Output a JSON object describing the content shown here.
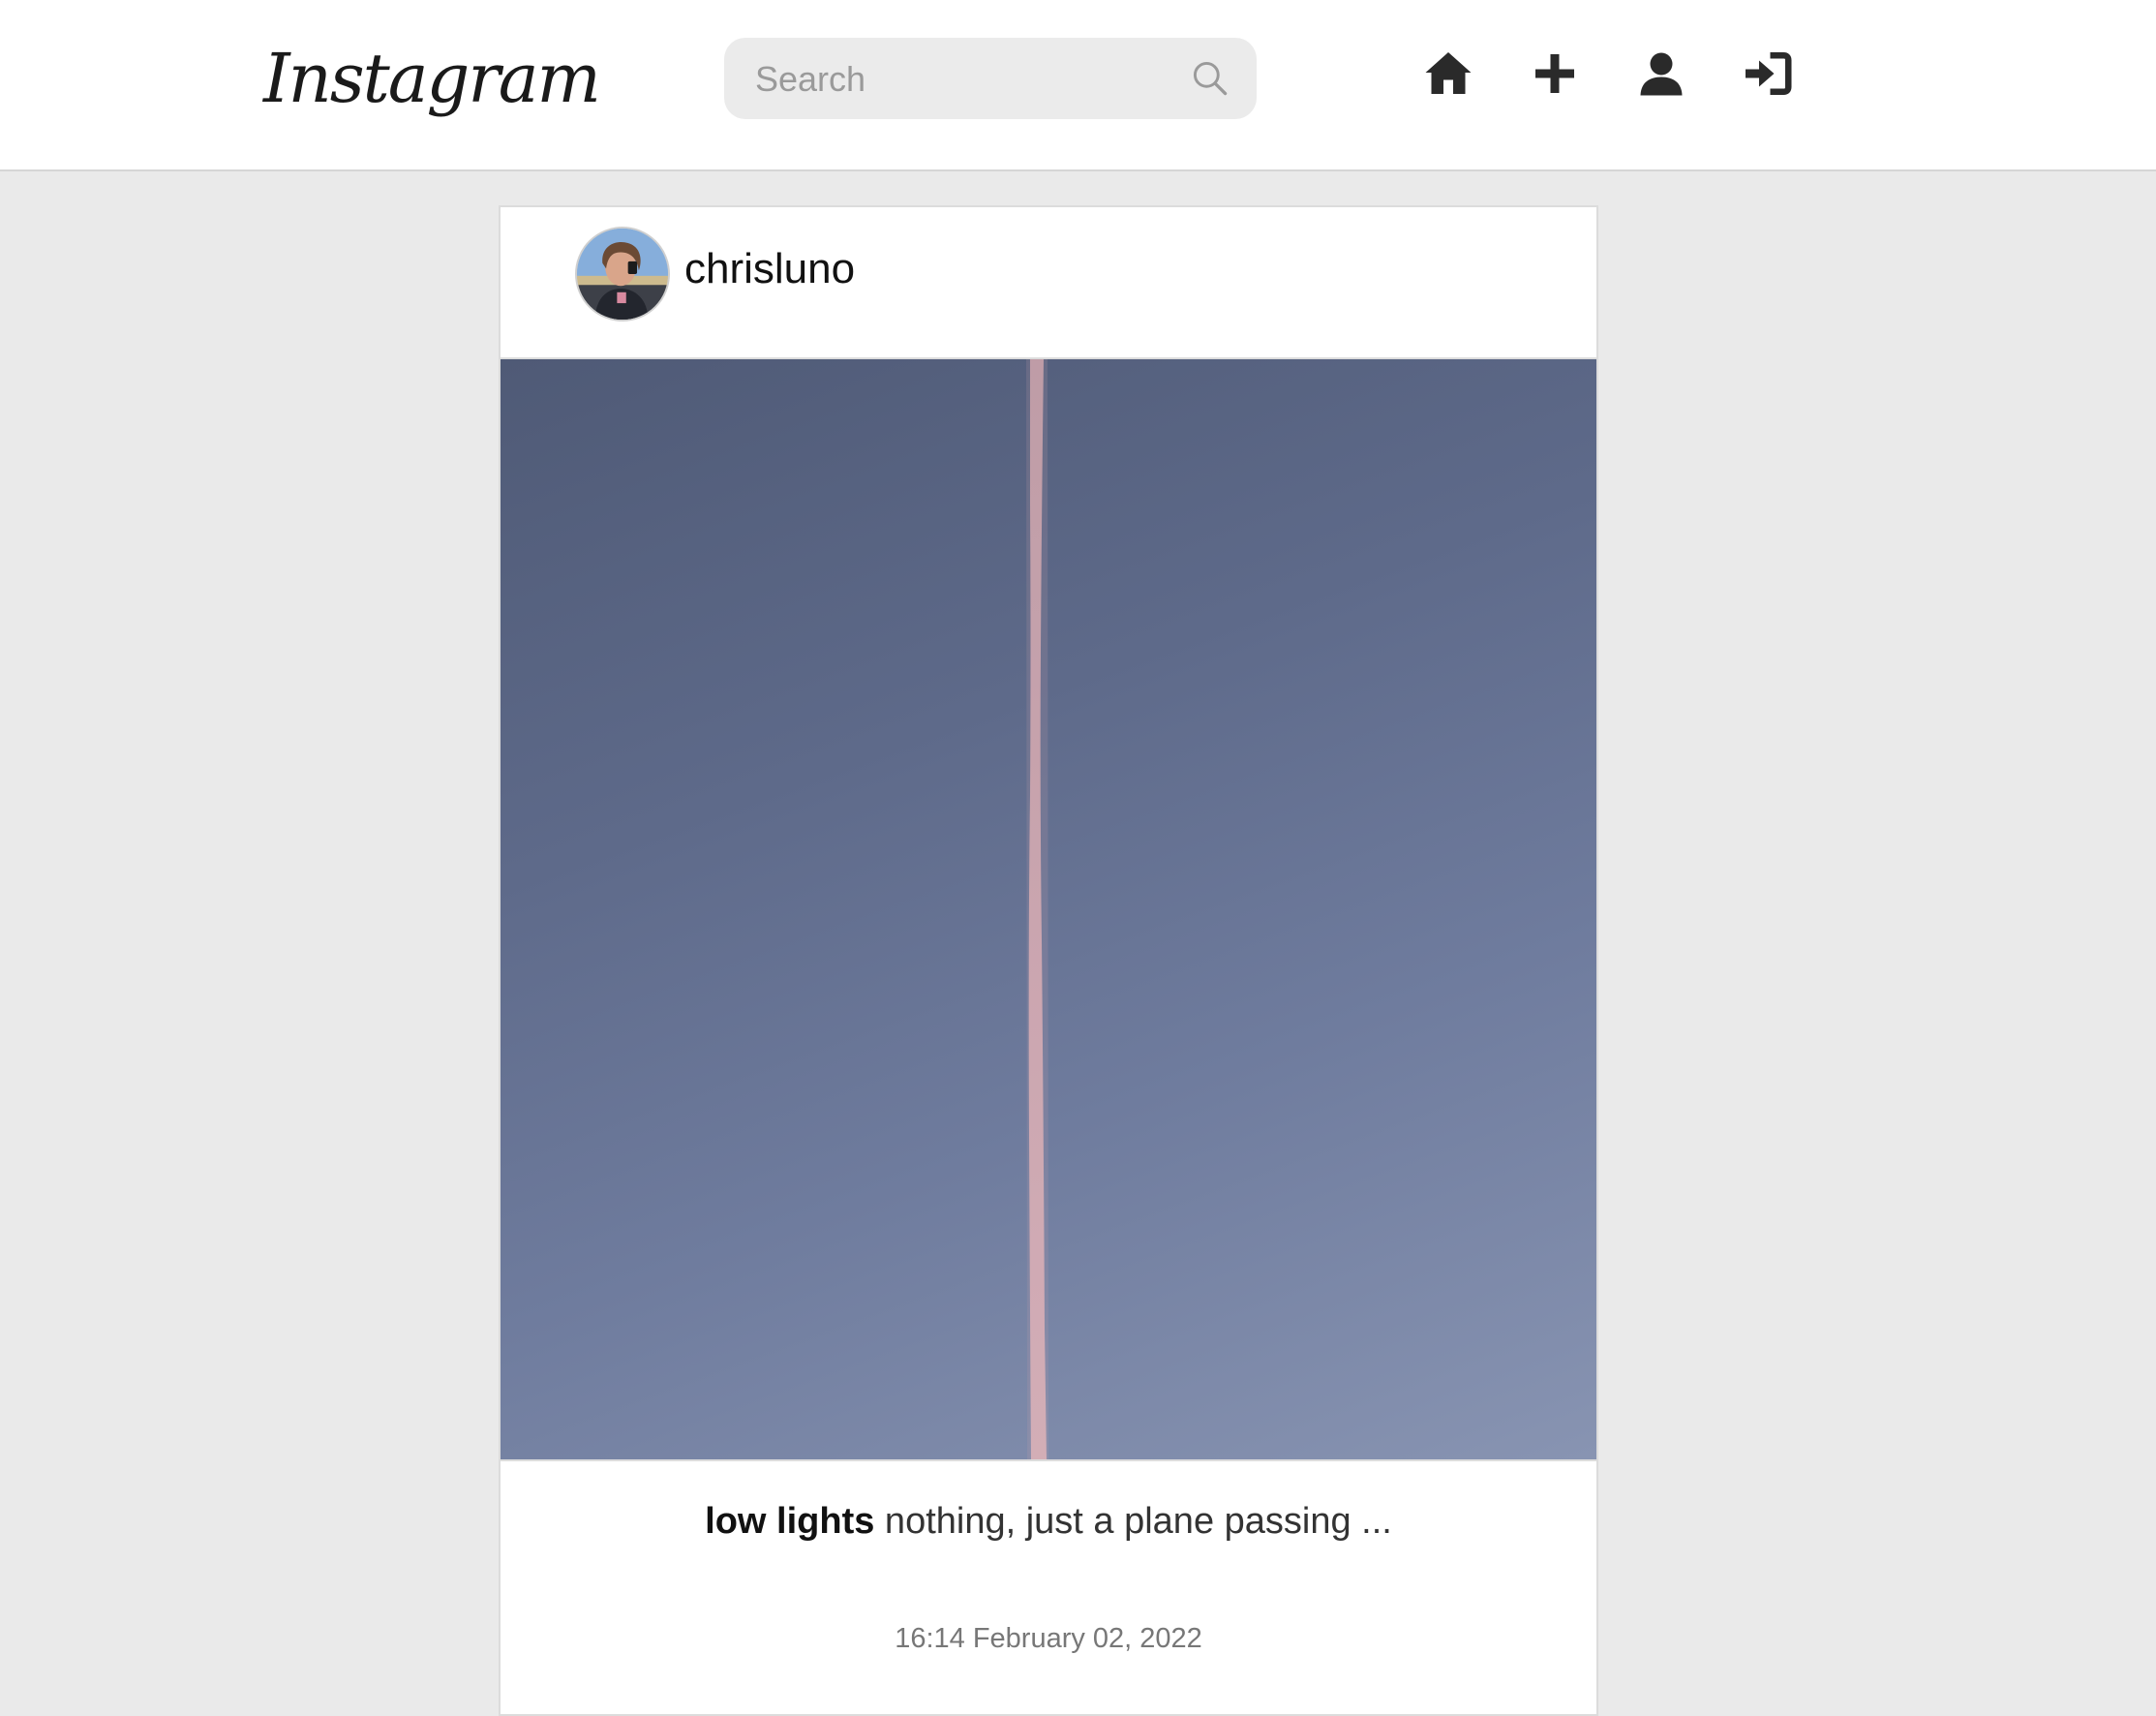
{
  "header": {
    "logo_text": "Instagram",
    "search": {
      "placeholder": "Search",
      "value": "",
      "icon": "search-icon"
    },
    "nav": [
      {
        "name": "home",
        "icon": "home-icon"
      },
      {
        "name": "new-post",
        "icon": "plus-icon"
      },
      {
        "name": "profile",
        "icon": "user-icon"
      },
      {
        "name": "login",
        "icon": "sign-in-icon"
      }
    ]
  },
  "post": {
    "username": "chrisluno",
    "avatar_icon": "avatar",
    "caption_title": "low lights",
    "caption_text": " nothing, just a plane passing ...",
    "timestamp": "16:14 February 02, 2022"
  },
  "colors": {
    "page_background": "#eaeaea",
    "header_background": "#ffffff",
    "search_background": "#ebebeb",
    "icon_color": "#2a2a2a",
    "timestamp_color": "#777777"
  }
}
